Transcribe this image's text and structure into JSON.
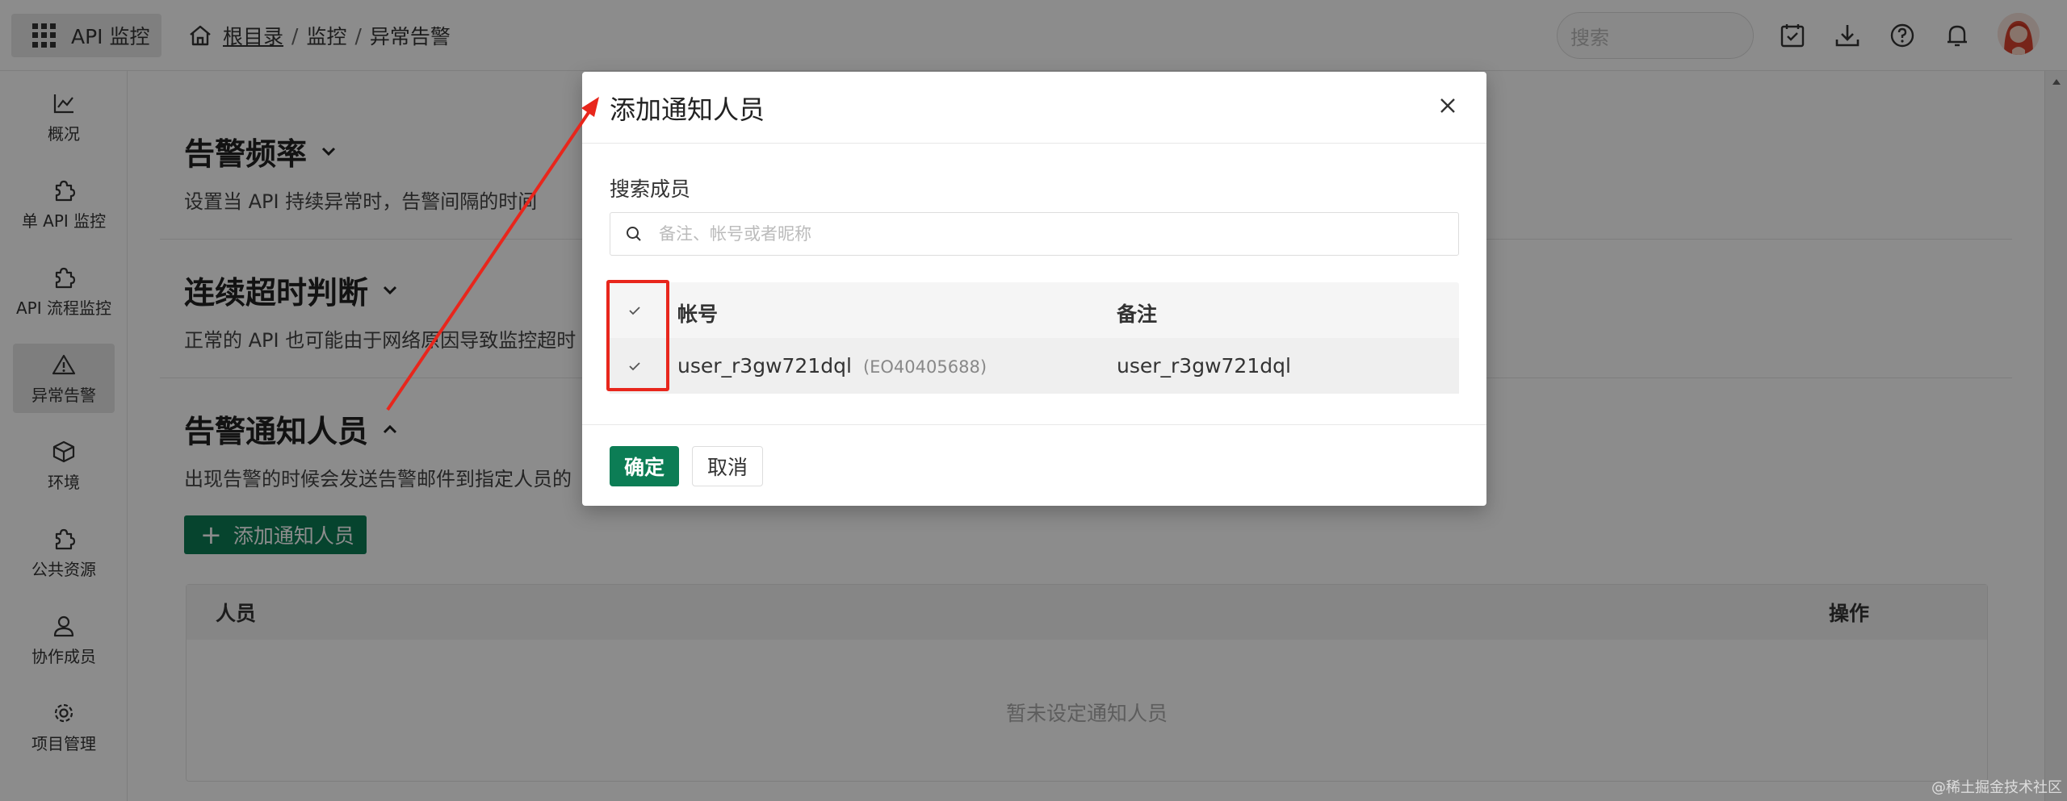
{
  "app": {
    "title": "API 监控"
  },
  "breadcrumb": {
    "root": "根目录",
    "sep": "/",
    "item1": "监控",
    "item2": "异常告警"
  },
  "search_top": {
    "placeholder": "搜索"
  },
  "sidebar": {
    "items": [
      {
        "label": "概况",
        "icon": "chart-line-icon"
      },
      {
        "label": "单 API 监控",
        "icon": "puzzle-icon"
      },
      {
        "label": "API 流程监控",
        "icon": "puzzle-icon"
      },
      {
        "label": "异常告警",
        "icon": "warning-icon",
        "active": true
      },
      {
        "label": "环境",
        "icon": "cube-icon"
      },
      {
        "label": "公共资源",
        "icon": "puzzle-icon"
      },
      {
        "label": "协作成员",
        "icon": "user-icon"
      },
      {
        "label": "项目管理",
        "icon": "gear-icon"
      }
    ]
  },
  "sections": {
    "frequency": {
      "title": "告警频率",
      "desc": "设置当 API 持续异常时，告警间隔的时间"
    },
    "timeout": {
      "title": "连续超时判断",
      "desc": "正常的 API 也可能由于网络原因导致监控超时"
    },
    "notify": {
      "title": "告警通知人员",
      "desc": "出现告警的时候会发送告警邮件到指定人员的"
    }
  },
  "add_button": {
    "label": "添加通知人员"
  },
  "people_table": {
    "columns": [
      "人员",
      "操作"
    ],
    "empty_text": "暂未设定通知人员"
  },
  "modal": {
    "title": "添加通知人员",
    "search_label": "搜索成员",
    "search_placeholder": "备注、帐号或者昵称",
    "columns": [
      "帐号",
      "备注"
    ],
    "rows": [
      {
        "account": "user_r3gw721dql",
        "account_id": "(EO40405688)",
        "remark": "user_r3gw721dql",
        "checked": true
      }
    ],
    "header_checked": true,
    "ok_label": "确定",
    "cancel_label": "取消"
  },
  "colors": {
    "primary": "#0c7d55",
    "annotation": "#e8261c"
  },
  "watermark": "@稀土掘金技术社区"
}
